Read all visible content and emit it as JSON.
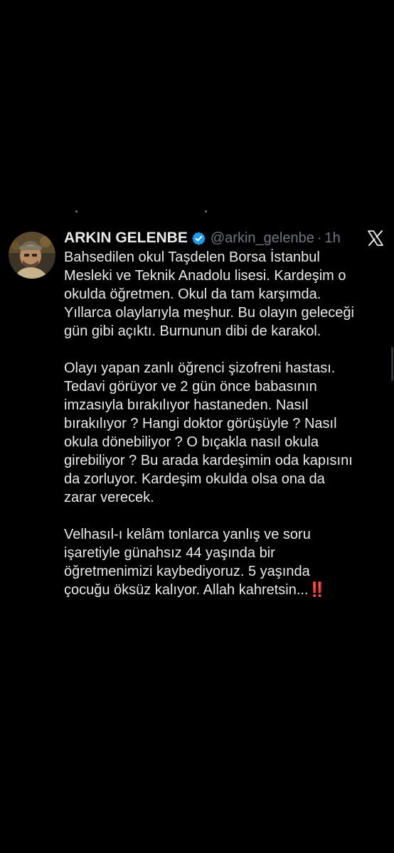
{
  "tweet": {
    "author_name": "ARKIN GELENBE",
    "handle": "@arkin_gelenbe",
    "separator": "·",
    "time": "1h",
    "avatar_icon": "user-avatar",
    "verified_icon": "verified-badge-icon",
    "logo_icon": "x-logo-icon",
    "paragraphs": [
      "Bahsedilen okul Taşdelen Borsa İstanbul\nMesleki ve Teknik Anadolu lisesi. Kardeşim o\nokulda öğretmen. Okul da tam karşımda.\nYıllarca olaylarıyla meşhur. Bu olayın geleceği\ngün gibi açıktı. Burnunun dibi de karakol.",
      "Olayı yapan zanlı öğrenci şizofreni hastası.\nTedavi görüyor ve 2 gün önce babasının\nimzasıyla bırakılıyor hastaneden. Nasıl\nbırakılıyor ? Hangi doktor görüşüyle ? Nasıl\nokula dönebiliyor ? O bıçakla nasıl okula\ngirebiliyor ? Bu arada kardeşimin oda kapısını\nda zorluyor. Kardeşim okulda olsa ona da\nzarar verecek.",
      "Velhasıl-ı kelâm tonlarca yanlış ve soru\nişaretiyle günahsız 44 yaşında bir\nöğretmenimizi kaybediyoruz. 5 yaşında\nçocuğu öksüz kalıyor. Allah kahretsin..."
    ],
    "trailing_emoji": "‼️"
  },
  "colors": {
    "background": "#000000",
    "text": "#e7e9ea",
    "secondary_text": "#71767b",
    "verified_blue": "#1d9bf0",
    "emoji_red": "#e0243c"
  }
}
